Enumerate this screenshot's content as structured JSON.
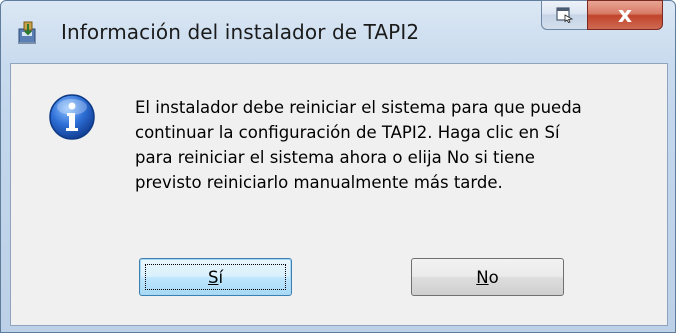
{
  "window": {
    "title": "Información del instalador de TAPI2",
    "title_icon": "installer-icon",
    "help_button_icon": "context-help-icon",
    "close_button_glyph": "x"
  },
  "dialog": {
    "icon": "information-icon",
    "message": "El instalador debe reiniciar el sistema para que pueda\ncontinuar la configuración de TAPI2. Haga clic en Sí\npara reiniciar el sistema ahora o elija No si tiene\nprevisto reiniciarlo manualmente más tarde.",
    "buttons": {
      "yes": {
        "mnemonic": "S",
        "rest": "í"
      },
      "no": {
        "mnemonic": "N",
        "rest": "o"
      }
    }
  },
  "colors": {
    "frame": "#c2d6ec",
    "close_button": "#c0442b",
    "info_icon_blue": "#1f5fc4",
    "default_button_border": "#3c7fb1"
  }
}
